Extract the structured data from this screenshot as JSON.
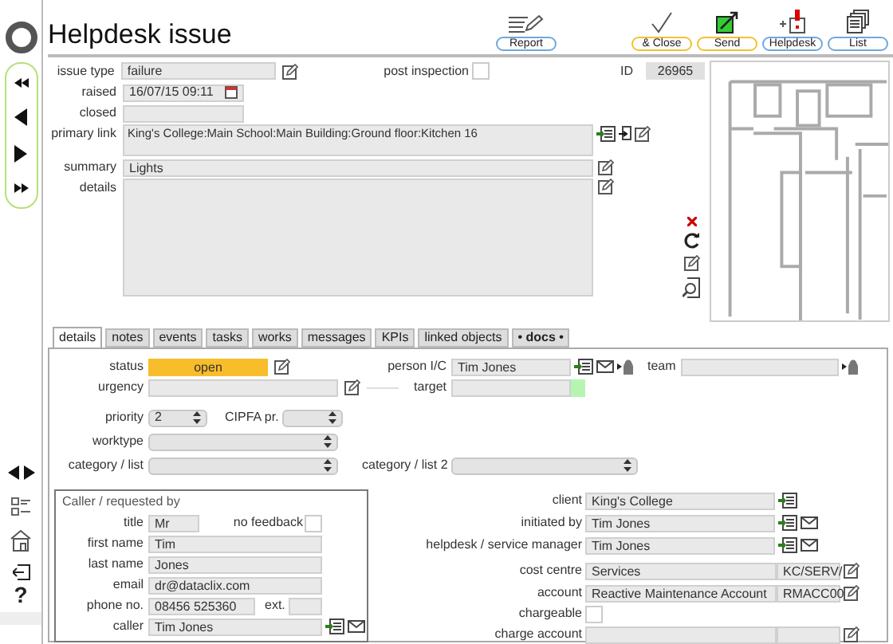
{
  "window": {
    "title": "Helpdesk issue"
  },
  "toolbar": [
    {
      "kind": "report",
      "label": "Report",
      "color": "#6fa8dc"
    },
    {
      "kind": "check",
      "label": "& Close",
      "color": "#f1c232"
    },
    {
      "kind": "send",
      "label": "Send",
      "color": "#f1c232"
    },
    {
      "kind": "helpdesk",
      "label": "Helpdesk",
      "color": "#6fa8dc"
    },
    {
      "kind": "list",
      "label": "List",
      "color": "#6fa8dc"
    }
  ],
  "sidebar": {
    "help": "?"
  },
  "header": {
    "issue_type": {
      "label": "issue type",
      "value": "failure"
    },
    "post_inspection": {
      "label": "post inspection",
      "checked": false
    },
    "id": {
      "label": "ID",
      "value": "26965"
    },
    "raised": {
      "label": "raised",
      "value": "16/07/15 09:11"
    },
    "closed": {
      "label": "closed"
    },
    "primary_link": {
      "label": "primary link",
      "value": "King's College:Main School:Main Building:Ground floor:Kitchen 16"
    },
    "summary": {
      "label": "summary",
      "value": "Lights"
    },
    "details": {
      "label": "details"
    }
  },
  "tabs": [
    {
      "label": "details",
      "selected": true
    },
    {
      "label": "notes",
      "selected": false
    },
    {
      "label": "events",
      "selected": false
    },
    {
      "label": "tasks",
      "selected": false
    },
    {
      "label": "works",
      "selected": false
    },
    {
      "label": "messages",
      "selected": false
    },
    {
      "label": "KPIs",
      "selected": false
    },
    {
      "label": "linked objects",
      "selected": false
    },
    {
      "label": "• docs •",
      "selected": false
    }
  ],
  "details": {
    "status": {
      "label": "status",
      "value": "open"
    },
    "person_ic": {
      "label": "person I/C",
      "value": "Tim Jones"
    },
    "team": {
      "label": "team"
    },
    "urgency": {
      "label": "urgency"
    },
    "target": {
      "label": "target"
    },
    "priority": {
      "label": "priority",
      "value": "2"
    },
    "cipfa": {
      "label": "CIPFA pr."
    },
    "worktype": {
      "label": "worktype"
    },
    "category": {
      "label": "category / list"
    },
    "category_2": {
      "label": "category / list 2"
    }
  },
  "caller": {
    "title": "Caller / requested by",
    "title_field": {
      "label": "title",
      "value": "Mr"
    },
    "no_feedback": {
      "label": "no feedback",
      "checked": false
    },
    "first_name": {
      "label": "first name",
      "value": "Tim"
    },
    "last_name": {
      "label": "last name",
      "value": "Jones"
    },
    "email": {
      "label": "email",
      "value": "dr@dataclix.com"
    },
    "phone": {
      "label": "phone no.",
      "value": "08456 525360"
    },
    "ext": {
      "label": "ext."
    },
    "caller": {
      "label": "caller",
      "value": "Tim Jones"
    }
  },
  "client": {
    "client": {
      "label": "client",
      "value": "King's College"
    },
    "initiated_by": {
      "label": "initiated by",
      "value": "Tim Jones"
    },
    "manager": {
      "label": "helpdesk / service manager",
      "value": "Tim Jones"
    },
    "cost_centre": {
      "label": "cost centre",
      "value": "Services",
      "code": "KC/SERV/"
    },
    "account": {
      "label": "account",
      "value": "Reactive Maintenance Account",
      "code": "RMACC00"
    },
    "chargeable": {
      "label": "chargeable",
      "checked": false
    },
    "charge_account": {
      "label": "charge account"
    }
  }
}
